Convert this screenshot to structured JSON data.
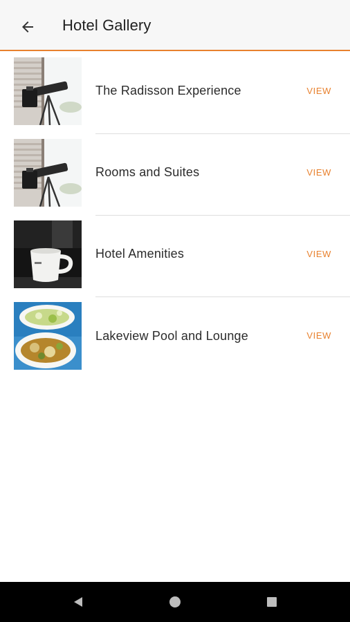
{
  "app_bar": {
    "title": "Hotel Gallery",
    "back_icon": "arrow-back-icon",
    "accent_color": "#e8812e"
  },
  "gallery": {
    "items": [
      {
        "label": "The Radisson Experience",
        "action": "VIEW",
        "thumbnail": "telescope-photo"
      },
      {
        "label": "Rooms and Suites",
        "action": "VIEW",
        "thumbnail": "telescope-photo"
      },
      {
        "label": "Hotel Amenities",
        "action": "VIEW",
        "thumbnail": "coffee-cup-photo"
      },
      {
        "label": "Lakeview Pool and Lounge",
        "action": "VIEW",
        "thumbnail": "food-bowls-photo"
      }
    ]
  },
  "system_nav": {
    "back_icon": "nav-back-triangle-icon",
    "home_icon": "nav-home-circle-icon",
    "recents_icon": "nav-recents-square-icon"
  }
}
